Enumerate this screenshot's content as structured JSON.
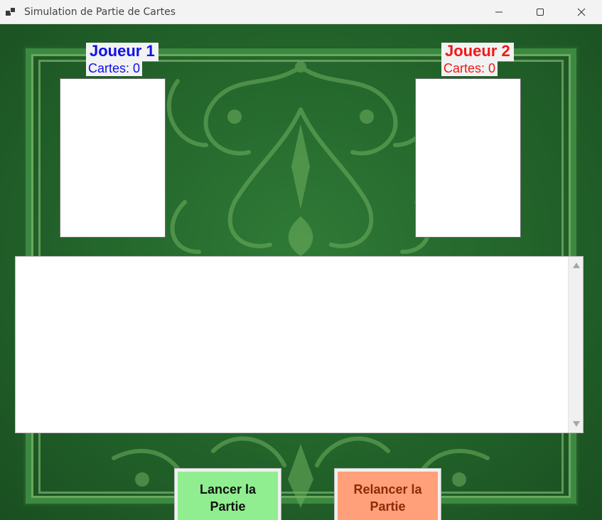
{
  "window": {
    "title": "Simulation de Partie de Cartes"
  },
  "players": [
    {
      "name": "Joueur 1",
      "cards_label": "Cartes: 0",
      "color": "#1010e8"
    },
    {
      "name": "Joueur 2",
      "cards_label": "Cartes: 0",
      "color": "#f01818"
    }
  ],
  "log": {
    "text": ""
  },
  "buttons": {
    "start_label": "Lancer la Partie",
    "restart_label": "Relancer la Partie",
    "start_color": "#90ee90",
    "restart_color": "#ffa07a"
  },
  "icons": {
    "app": "app-icon",
    "minimize": "minimize-icon",
    "maximize": "maximize-icon",
    "close": "close-icon"
  }
}
